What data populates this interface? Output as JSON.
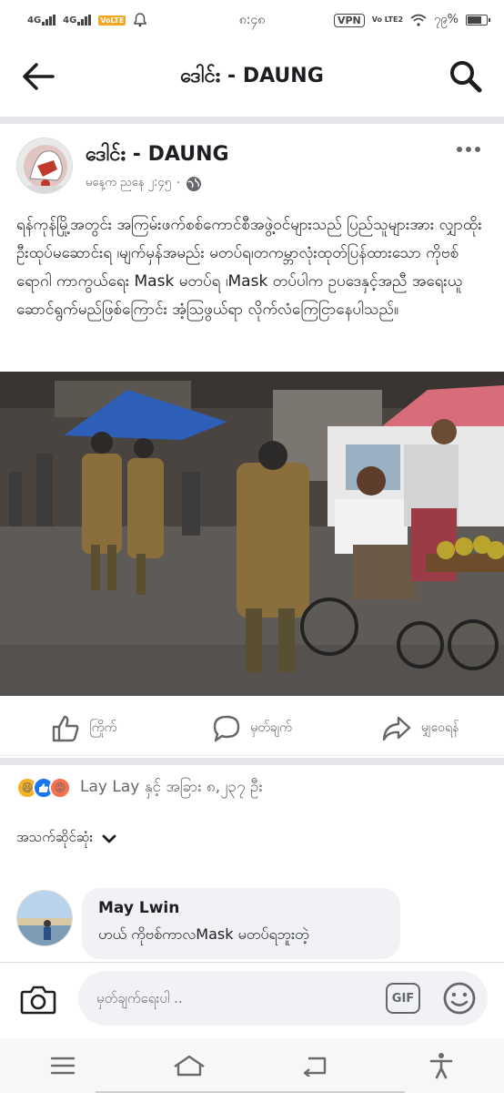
{
  "status_bar": {
    "network1": "4G",
    "network2": "4G",
    "volte_badge": "VoLTE",
    "time": "၈:၄၈",
    "vpn": "VPN",
    "volte_small": "Vo LTE2",
    "battery": "၇၉%",
    "battery_level": 0.79
  },
  "header": {
    "title": "ဒေါင်း - DAUNG"
  },
  "post": {
    "page_name": "ဒေါင်း - DAUNG",
    "time": "မနေ့က ညနေ ၂:၄၅",
    "separator": "·",
    "text": "ရန်ကုန်မြို့အတွင်း အကြမ်းဖက်စစ်ကောင်စီအဖွဲ့ဝင်များသည် ပြည်သူများအား လျှာထိုးဦးထုပ်မဆောင်းရ ၊မျက်မှန်အမည်း မတပ်ရ၊တကမ္ဘာလုံးထုတ်ပြန်ထားသော ကိုဗစ်ရောဂါ ကာကွယ်ရေး Mask မတပ်ရ ၊Mask တပ်ပါက ဥပဒေနှင့်အညီ အရေးယူဆောင်ရွက်မည်ဖြစ်ကြောင်း အံ့သြဖွယ်ရာ လိုက်လံကြေငြာနေပါသည်။"
  },
  "actions": {
    "like": "ကြိုက်",
    "comment": "မှတ်ချက်",
    "share": "မျှဝေရန်"
  },
  "reactions": {
    "text": "Lay Lay နှင့် အခြား ၈,၂၃၇ ဦး"
  },
  "sort": {
    "label": "အသက်ဆိုင်ဆုံး"
  },
  "comment": {
    "author": "May Lwin",
    "text": "ဟယ် ကိုဗစ်ကာလMask မတပ်ရဘူးတဲ့"
  },
  "composer": {
    "placeholder": "မှတ်ချက်ရေးပါ ..",
    "gif_label": "GIF"
  },
  "colors": {
    "text": "#1c1e21",
    "secondary": "#65676b",
    "bubble": "#f0f2f5",
    "divider": "#e4e6eb",
    "like_blue": "#1877f2",
    "angry_orange": "#f7714c",
    "haha_yellow": "#f7b125"
  },
  "icons": {
    "back": "arrow-left-icon",
    "search": "search-icon",
    "more": "more-dots-icon",
    "globe": "globe-icon",
    "like": "thumbs-up-icon",
    "comment": "speech-bubble-icon",
    "share": "share-arrow-icon",
    "camera": "camera-icon",
    "emoji": "smiley-icon"
  }
}
